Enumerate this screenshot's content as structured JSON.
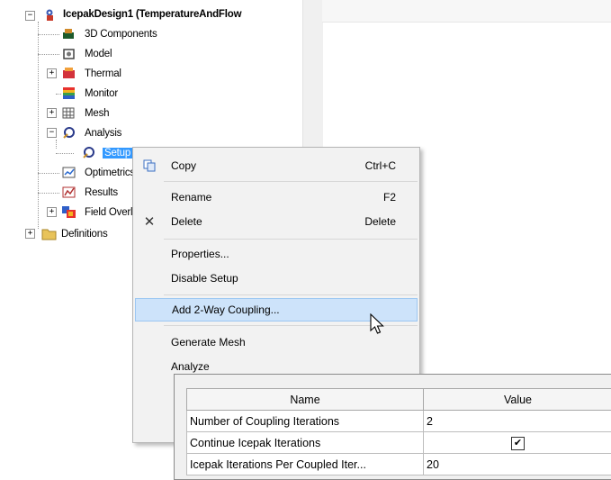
{
  "tree": {
    "root_label": "IcepakDesign1 (TemperatureAndFlow",
    "items": [
      {
        "label": "3D Components",
        "icon": "components-icon"
      },
      {
        "label": "Model",
        "icon": "model-icon"
      },
      {
        "label": "Thermal",
        "icon": "thermal-icon"
      },
      {
        "label": "Monitor",
        "icon": "monitor-icon"
      },
      {
        "label": "Mesh",
        "icon": "mesh-icon"
      },
      {
        "label": "Analysis",
        "icon": "analysis-icon"
      },
      {
        "label": "Setup",
        "icon": "setup-icon"
      },
      {
        "label": "Optimetrics",
        "icon": "optimetrics-icon"
      },
      {
        "label": "Results",
        "icon": "results-icon"
      },
      {
        "label": "Field Overlays",
        "icon": "field-overlays-icon"
      },
      {
        "label": "Definitions",
        "icon": "folder-icon"
      }
    ],
    "expand_plus": "+",
    "expand_minus": "−"
  },
  "context_menu": {
    "copy": "Copy",
    "copy_shortcut": "Ctrl+C",
    "rename": "Rename",
    "rename_shortcut": "F2",
    "delete": "Delete",
    "delete_shortcut": "Delete",
    "properties": "Properties...",
    "disable_setup": "Disable Setup",
    "add_coupling": "Add 2-Way Coupling...",
    "generate_mesh": "Generate Mesh",
    "analyze": "Analyze",
    "delete_icon_glyph": "✕"
  },
  "properties_table": {
    "headers": [
      "Name",
      "Value"
    ],
    "rows": [
      {
        "name": "Number of Coupling Iterations",
        "value": "2"
      },
      {
        "name": "Continue Icepak Iterations",
        "value": "✔"
      },
      {
        "name": "Icepak Iterations Per Coupled Iter...",
        "value": "20"
      }
    ]
  },
  "colors": {
    "selection": "#3399ff",
    "menu_highlight": "#cde3fa",
    "menu_background": "#f2f2f2"
  }
}
